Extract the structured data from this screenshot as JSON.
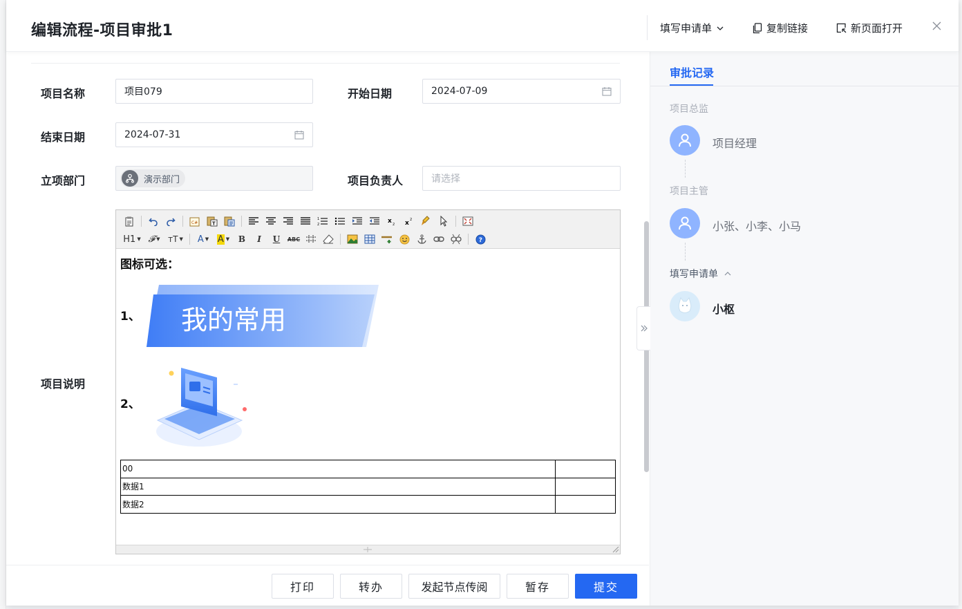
{
  "dialog": {
    "title": "编辑流程-项目审批1",
    "actions": {
      "fill_form": "填写申请单",
      "copy_link": "复制链接",
      "open_new_page": "新页面打开"
    }
  },
  "form": {
    "project_name": {
      "label": "项目名称",
      "value": "项目079"
    },
    "start_date": {
      "label": "开始日期",
      "value": "2024-07-09"
    },
    "end_date": {
      "label": "结束日期",
      "value": "2024-07-31"
    },
    "department": {
      "label": "立项部门",
      "value": "演示部门"
    },
    "owner": {
      "label": "项目负责人",
      "placeholder": "请选择"
    },
    "description": {
      "label": "项目说明",
      "heading": "图标可选：",
      "item1": "1、",
      "item2": "2、",
      "banner_text": "我的常用",
      "table": [
        [
          "00",
          ""
        ],
        [
          "数据1",
          ""
        ],
        [
          "数据2",
          ""
        ]
      ]
    }
  },
  "toolbar": {
    "row1": [
      "source-icon",
      "undo-icon",
      "redo-icon",
      "paste-word-icon",
      "paste-text-icon",
      "paste-icon",
      "align-left-icon",
      "align-center-icon",
      "align-right-icon",
      "justify-icon",
      "ordered-list-icon",
      "unordered-list-icon",
      "indent-icon",
      "outdent-icon",
      "subscript-icon",
      "superscript-icon",
      "format-painter-icon",
      "select-all-icon",
      "fullscreen-icon"
    ],
    "heading_label": "H1",
    "font_label": "𝓕",
    "size_label": "тT",
    "bold": "B",
    "italic": "I",
    "underline": "U",
    "strike": "ABC"
  },
  "footer": {
    "print": "打印",
    "transfer": "转办",
    "circulate": "发起节点传阅",
    "save_draft": "暂存",
    "submit": "提交"
  },
  "approval": {
    "tab": "审批记录",
    "nodes": [
      {
        "title": "项目总监",
        "assignee": "项目经理"
      },
      {
        "title": "项目主管",
        "assignee": "小张、小李、小马"
      },
      {
        "title": "填写申请单",
        "assignee": "小枢"
      }
    ]
  },
  "colors": {
    "primary": "#2468f2",
    "avatar": "#8fb4ff"
  }
}
